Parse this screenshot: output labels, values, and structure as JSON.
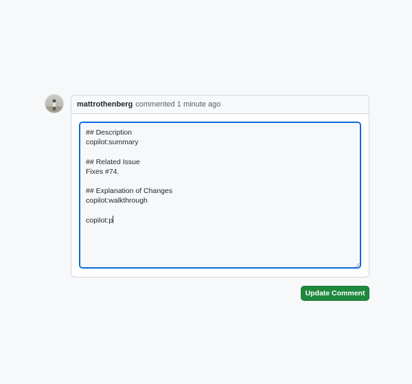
{
  "comment": {
    "author": "mattrothenberg",
    "action": "commented",
    "time": "1 minute ago",
    "avatar_icon": "user-avatar-photo"
  },
  "editor": {
    "lines": [
      "## Description",
      "copilot:summary",
      "",
      "## Related Issue",
      "Fixes #74.",
      "",
      "## Explanation of Changes",
      "copilot:walkthrough",
      "",
      "copilot:p"
    ],
    "resize_icon": "resize-grip-icon"
  },
  "actions": {
    "update_label": "Update Comment"
  },
  "colors": {
    "page_background": "#f6f8fa",
    "focus_border": "#0969da",
    "button_green": "#1f883d"
  }
}
